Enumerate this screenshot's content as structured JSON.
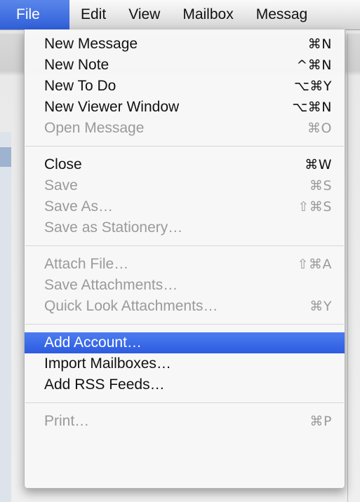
{
  "menubar": {
    "items": [
      {
        "label": "File"
      },
      {
        "label": "Edit"
      },
      {
        "label": "View"
      },
      {
        "label": "Mailbox"
      },
      {
        "label": "Messag"
      }
    ]
  },
  "file_menu": {
    "groups": [
      [
        {
          "label": "New Message",
          "shortcut": "⌘N"
        },
        {
          "label": "New Note",
          "shortcut": "^⌘N"
        },
        {
          "label": "New To Do",
          "shortcut": "⌥⌘Y"
        },
        {
          "label": "New Viewer Window",
          "shortcut": "⌥⌘N"
        },
        {
          "label": "Open Message",
          "shortcut": "⌘O"
        }
      ],
      [
        {
          "label": "Close",
          "shortcut": "⌘W"
        },
        {
          "label": "Save",
          "shortcut": "⌘S"
        },
        {
          "label": "Save As…",
          "shortcut": "⇧⌘S"
        },
        {
          "label": "Save as Stationery…",
          "shortcut": ""
        }
      ],
      [
        {
          "label": "Attach File…",
          "shortcut": "⇧⌘A"
        },
        {
          "label": "Save Attachments…",
          "shortcut": ""
        },
        {
          "label": "Quick Look Attachments…",
          "shortcut": "⌘Y"
        }
      ],
      [
        {
          "label": "Add Account…",
          "shortcut": ""
        },
        {
          "label": "Import Mailboxes…",
          "shortcut": ""
        },
        {
          "label": "Add RSS Feeds…",
          "shortcut": ""
        }
      ],
      [
        {
          "label": "Print…",
          "shortcut": "⌘P"
        }
      ]
    ]
  }
}
